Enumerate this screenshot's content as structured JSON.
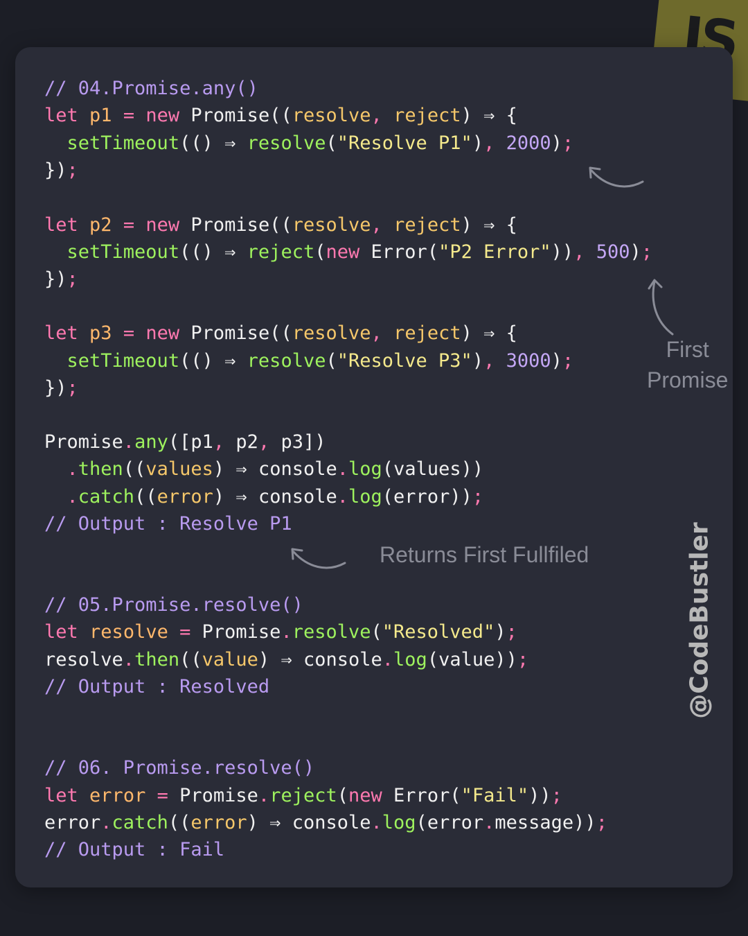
{
  "badge": {
    "label": "JS"
  },
  "handle": "@CodeBustler",
  "annotations": {
    "first_promise": "First\nPromise",
    "returns_first": "Returns First Fullfiled"
  },
  "code": {
    "section04": {
      "comment": "// 04.Promise.any()",
      "p1_decl": "let p1 = new Promise((resolve, reject) ⇒ {",
      "p1_body": "  setTimeout(() ⇒ resolve(\"Resolve P1\"), 2000);",
      "p1_close": "});",
      "p2_decl": "let p2 = new Promise((resolve, reject) ⇒ {",
      "p2_body": "  setTimeout(() ⇒ reject(new Error(\"P2 Error\")), 500);",
      "p2_close": "});",
      "p3_decl": "let p3 = new Promise((resolve, reject) ⇒ {",
      "p3_body": "  setTimeout(() ⇒ resolve(\"Resolve P3\"), 3000);",
      "p3_close": "});",
      "any_call": "Promise.any([p1, p2, p3])",
      "then_call": "  .then((values) ⇒ console.log(values))",
      "catch_call": "  .catch((error) ⇒ console.log(error));",
      "output": "// Output : Resolve P1"
    },
    "section05": {
      "comment": "// 05.Promise.resolve()",
      "decl": "let resolve = Promise.resolve(\"Resolved\");",
      "then_call": "resolve.then((value) ⇒ console.log(value));",
      "output": "// Output : Resolved"
    },
    "section06": {
      "comment": "// 06. Promise.resolve()",
      "decl": "let error = Promise.reject(new Error(\"Fail\"));",
      "catch_call": "error.catch((error) ⇒ console.log(error.message));",
      "output": "// Output : Fail"
    }
  },
  "colors": {
    "background": "#1c1e26",
    "panel": "#2a2c37",
    "comment": "#b99bf0",
    "keyword": "#ff79b0",
    "variable": "#ffb86c",
    "function": "#9ef25e",
    "string": "#f4e98c",
    "number": "#c4a7f5",
    "badge": "#6e6a2c"
  }
}
